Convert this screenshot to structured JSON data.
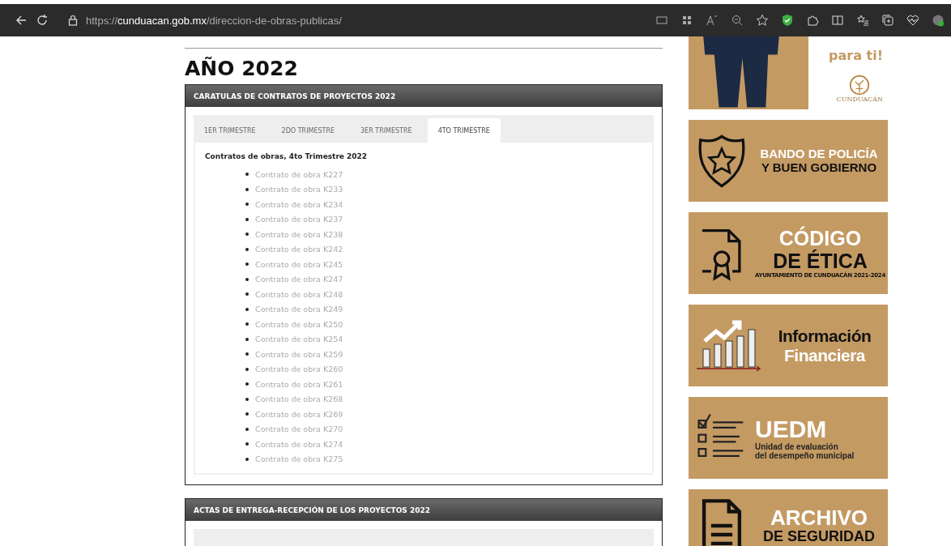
{
  "browser": {
    "url": "https://**cunduacan.gob.mx**/direccion-de-obras-publicas/"
  },
  "heading": "AÑO 2022",
  "panels": [
    {
      "title": "CARATULAS DE CONTRATOS DE PROYECTOS 2022",
      "tabs": [
        {
          "label": "1ER TRIMESTRE",
          "selected": false
        },
        {
          "label": "2DO TRIMESTRE",
          "selected": false
        },
        {
          "label": "3ER TRIMESTRE",
          "selected": false
        },
        {
          "label": "4TO TRIMESTRE",
          "selected": true
        }
      ],
      "content_title": "Contratos de obras, 4to Trimestre 2022",
      "links": [
        "Contrato de obra K227",
        "Contrato de obra K233",
        "Contrato de obra K234",
        "Contrato de obra K237",
        "Contrato de obra K238",
        "Contrato de obra K242",
        "Contrato de obra K245",
        "Contrato de obra K247",
        "Contrato de obra K248",
        "Contrato de obra K249",
        "Contrato de obra K250",
        "Contrato de obra K254",
        "Contrato de obra K259",
        "Contrato de obra K260",
        "Contrato de obra K261",
        "Contrato de obra K268",
        "Contrato de obra K269",
        "Contrato de obra K270",
        "Contrato de obra K274",
        "Contrato de obra K275"
      ]
    },
    {
      "title": "ACTAS DE ENTREGA-RECEPCIÓN DE LOS PROYECTOS 2022"
    }
  ],
  "banners": [
    {
      "kind": "empleo",
      "lines": [
        "para ti!"
      ],
      "logo": "CUNDUACÁN"
    },
    {
      "kind": "bando",
      "lines": [
        "BANDO DE POLICÍA",
        "Y BUEN GOBIERNO"
      ]
    },
    {
      "kind": "codigo",
      "lines": [
        "CÓDIGO",
        "DE ÉTICA"
      ],
      "note": "AYUNTAMIENTO DE CUNDUACÁN 2021-2024"
    },
    {
      "kind": "finanzas",
      "lines": [
        "Información",
        "Financiera"
      ]
    },
    {
      "kind": "uedm",
      "lines": [
        "UEDM",
        "Unidad de evaluación",
        "del desempeño municipal"
      ]
    },
    {
      "kind": "archivo",
      "lines": [
        "ARCHIVO",
        "DE SEGURIDAD"
      ]
    }
  ]
}
